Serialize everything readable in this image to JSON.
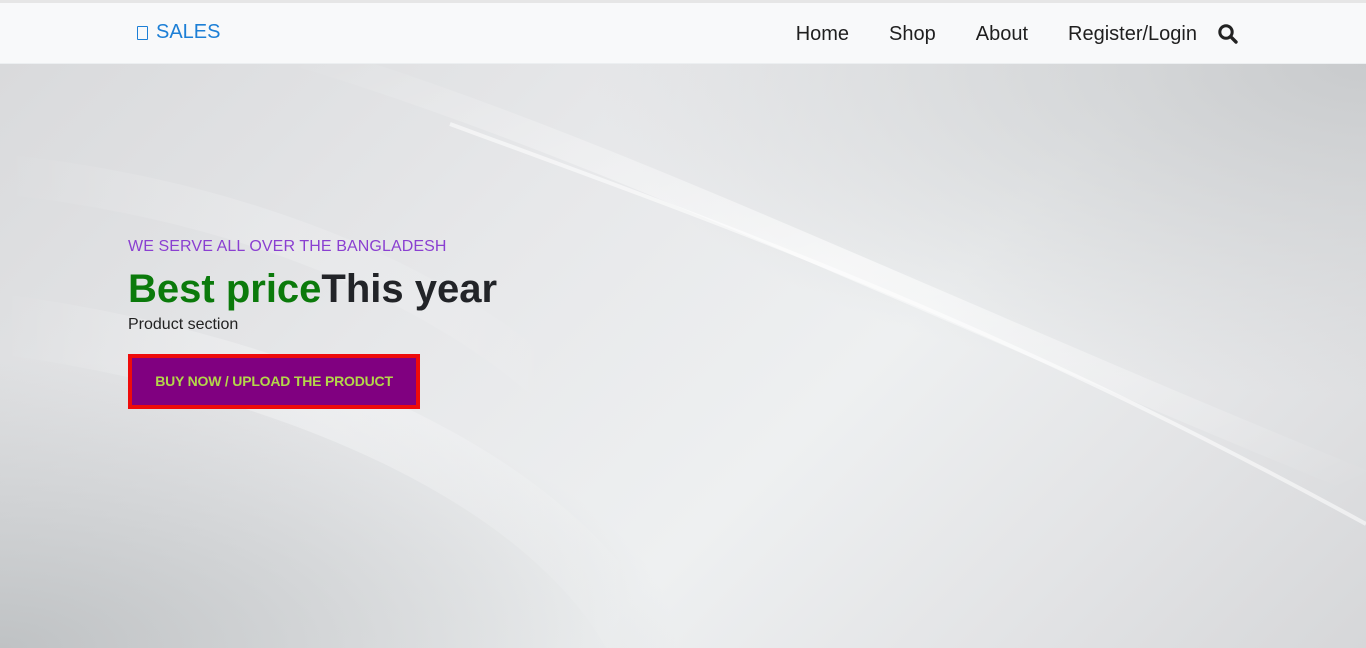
{
  "navbar": {
    "brand_label": "SALES",
    "brand_icon": "shopping-bag-icon",
    "links": [
      "Home",
      "Shop",
      "About",
      "Register/Login"
    ],
    "search_icon": "search-icon"
  },
  "hero": {
    "tagline": "WE SERVE ALL OVER THE BANGLADESH",
    "headline_highlight": "Best price",
    "headline_rest": "This year",
    "subtext": "Product section",
    "cta_label": "BUY NOW / UPLOAD THE PRODUCT"
  },
  "colors": {
    "brand": "#1c7fd6",
    "tagline": "#8a3fd1",
    "highlight": "#0b7a0b",
    "cta_bg": "#800080",
    "cta_border": "#ee0b0b",
    "cta_text": "#b3d64a"
  }
}
